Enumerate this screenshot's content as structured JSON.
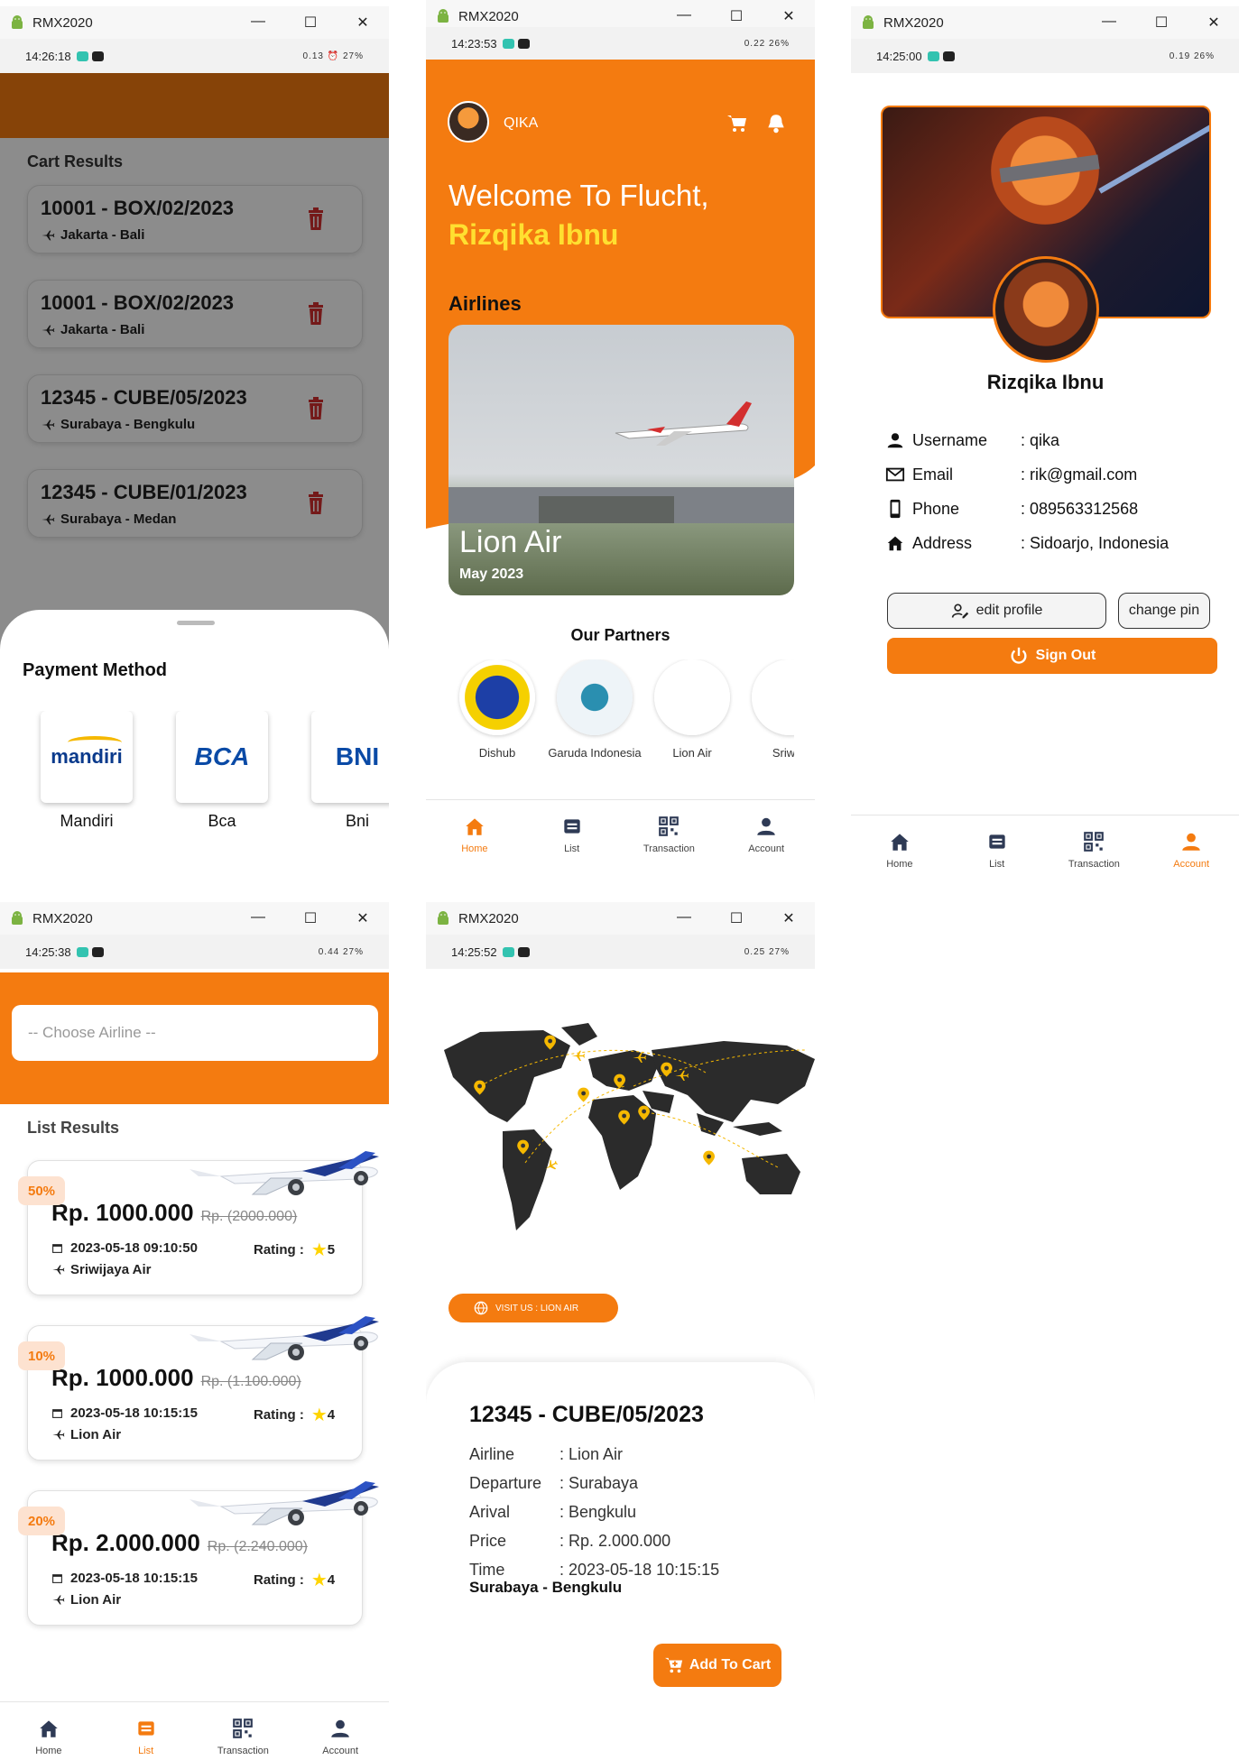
{
  "windows": {
    "title": "RMX2020",
    "controls": [
      "—",
      "☐",
      "✕"
    ]
  },
  "nav": {
    "home": "Home",
    "list": "List",
    "transaction": "Transaction",
    "account": "Account"
  },
  "colors": {
    "accent": "#f47b10",
    "danger": "#d32f2f",
    "yellow": "#ffd400"
  },
  "cart": {
    "time": "14:26:18",
    "status_right": "0.13 ⏰ 27%",
    "header": "Cart Results",
    "items": [
      {
        "code": "10001 - BOX/02/2023",
        "route": "Jakarta - Bali"
      },
      {
        "code": "10001 - BOX/02/2023",
        "route": "Jakarta - Bali"
      },
      {
        "code": "12345 - CUBE/05/2023",
        "route": "Surabaya - Bengkulu"
      },
      {
        "code": "12345 - CUBE/01/2023",
        "route": "Surabaya - Medan"
      }
    ],
    "payment_title": "Payment Method",
    "payments": [
      {
        "logo": "mandiri",
        "name": "Mandiri"
      },
      {
        "logo": "BCA",
        "name": "Bca"
      },
      {
        "logo": "BNI",
        "name": "Bni"
      }
    ]
  },
  "home": {
    "time": "14:23:53",
    "status_right": "0.22 26%",
    "username": "QIKA",
    "welcome": "Welcome To Flucht,",
    "name": "Rizqika Ibnu",
    "airlines_title": "Airlines",
    "featured_airline": "Lion Air",
    "featured_date": "May 2023",
    "partners_title": "Our Partners",
    "partners": [
      "Dishub",
      "Garuda Indonesia",
      "Lion Air",
      "Sriwija"
    ]
  },
  "account": {
    "time": "14:25:00",
    "status_right": "0.19 26%",
    "name": "Rizqika Ibnu",
    "fields": [
      {
        "icon": "user-icon",
        "label": "Username",
        "value": ": qika"
      },
      {
        "icon": "email-icon",
        "label": "Email",
        "value": ": rik@gmail.com"
      },
      {
        "icon": "phone-icon",
        "label": "Phone",
        "value": ": 089563312568"
      },
      {
        "icon": "home-icon",
        "label": "Address",
        "value": ": Sidoarjo, Indonesia"
      }
    ],
    "edit_profile": "edit profile",
    "change_pin": "change pin",
    "sign_out": "Sign Out"
  },
  "list": {
    "time": "14:25:38",
    "status_right": "0.44 27%",
    "select_placeholder": "-- Choose Airline --",
    "header": "List Results",
    "items": [
      {
        "discount": "50%",
        "price": "Rp. 1000.000",
        "old_price": "Rp. (2000.000)",
        "datetime": "2023-05-18 09:10:50",
        "rating_label": "Rating :",
        "rating": "5",
        "airline": "Sriwijaya Air"
      },
      {
        "discount": "10%",
        "price": "Rp. 1000.000",
        "old_price": "Rp. (1.100.000)",
        "datetime": "2023-05-18 10:15:15",
        "rating_label": "Rating :",
        "rating": "4",
        "airline": "Lion Air"
      },
      {
        "discount": "20%",
        "price": "Rp. 2.000.000",
        "old_price": "Rp. (2.240.000)",
        "datetime": "2023-05-18 10:15:15",
        "rating_label": "Rating :",
        "rating": "4",
        "airline": "Lion Air"
      }
    ]
  },
  "detail": {
    "time": "14:25:52",
    "status_right": "0.25 27%",
    "visit_button": "VISIT US : LION AIR",
    "code": "12345 - CUBE/05/2023",
    "fields": [
      {
        "label": "Airline",
        "value": ": Lion Air"
      },
      {
        "label": "Departure",
        "value": ": Surabaya"
      },
      {
        "label": "Arival",
        "value": ": Bengkulu"
      },
      {
        "label": "Price",
        "value": ": Rp. 2.000.000"
      },
      {
        "label": "Time",
        "value": ": 2023-05-18 10:15:15"
      }
    ],
    "route": "Surabaya - Bengkulu",
    "add_to_cart": "Add To Cart"
  }
}
